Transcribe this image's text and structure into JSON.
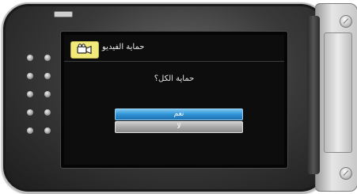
{
  "screen": {
    "title": "حماية الفيديو",
    "mode_icon": "video-camera-icon",
    "question": "حماية الكل؟",
    "options": {
      "yes_label": "نعم",
      "no_label": "لا"
    },
    "selected_option": "yes"
  },
  "colors": {
    "mode_badge": "#f1e97a",
    "selected_button": "#2e93d6",
    "unselected_button": "#a9a9a9"
  }
}
